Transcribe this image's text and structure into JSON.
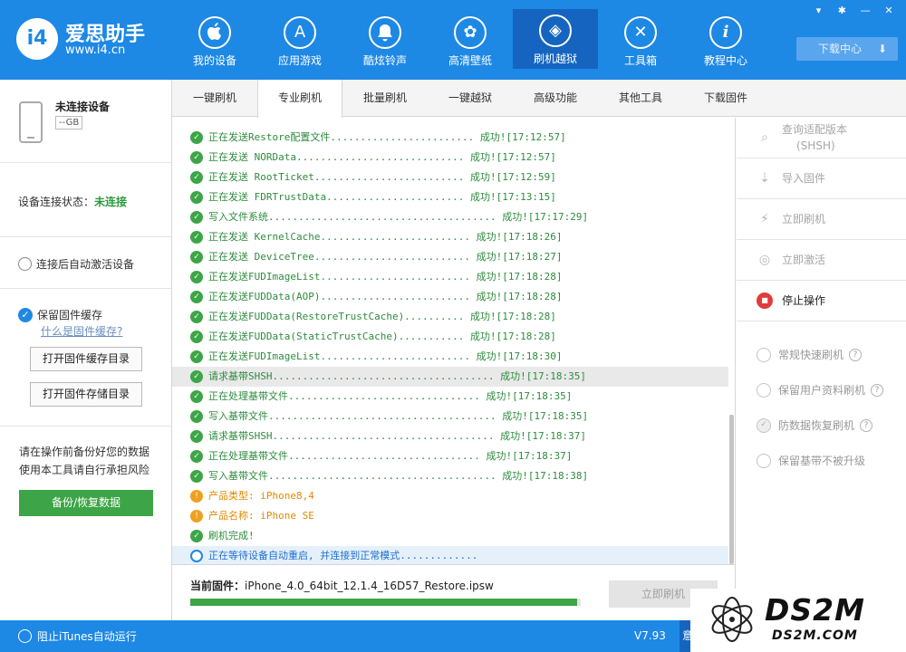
{
  "header": {
    "logo_mark": "i4",
    "app_name": "爱思助手",
    "url": "www.i4.cn",
    "nav": [
      {
        "label": "我的设备",
        "icon": "apple-icon",
        "glyph": ""
      },
      {
        "label": "应用游戏",
        "icon": "app-store-icon",
        "glyph": "A"
      },
      {
        "label": "酷炫铃声",
        "icon": "bell-icon",
        "glyph": "♪"
      },
      {
        "label": "高清壁纸",
        "icon": "flower-icon",
        "glyph": "✿"
      },
      {
        "label": "刷机越狱",
        "icon": "dropbox-icon",
        "glyph": "◈"
      },
      {
        "label": "工具箱",
        "icon": "tools-icon",
        "glyph": "✕"
      },
      {
        "label": "教程中心",
        "icon": "info-icon",
        "glyph": "i"
      }
    ],
    "download_center": "下载中心",
    "window_icons": [
      "shirt-icon",
      "gear-icon",
      "minimize-icon",
      "close-icon"
    ]
  },
  "left": {
    "device_name": "未连接设备",
    "device_storage": "--GB",
    "conn_label": "设备连接状态：",
    "conn_value": "未连接",
    "auto_activate": "连接后自动激活设备",
    "keep_cache": "保留固件缓存",
    "what_cache": "什么是固件缓存?",
    "open_cache_dir": "打开固件缓存目录",
    "open_store_dir": "打开固件存储目录",
    "warn1": "请在操作前备份好您的数据",
    "warn2": "使用本工具请自行承担风险",
    "backup": "备份/恢复数据"
  },
  "tabs": [
    "一键刷机",
    "专业刷机",
    "批量刷机",
    "一键越狱",
    "高级功能",
    "其他工具",
    "下载固件"
  ],
  "log": [
    {
      "text": "正在发送Restore配置文件........................ 成功![17:12:57]",
      "kind": "ok"
    },
    {
      "text": "正在发送 NORData............................ 成功![17:12:57]",
      "kind": "ok"
    },
    {
      "text": "正在发送 RootTicket......................... 成功![17:12:59]",
      "kind": "ok"
    },
    {
      "text": "正在发送 FDRTrustData....................... 成功![17:13:15]",
      "kind": "ok"
    },
    {
      "text": "写入文件系统...................................... 成功![17:17:29]",
      "kind": "ok"
    },
    {
      "text": "正在发送 KernelCache......................... 成功![17:18:26]",
      "kind": "ok"
    },
    {
      "text": "正在发送 DeviceTree.......................... 成功![17:18:27]",
      "kind": "ok"
    },
    {
      "text": "正在发送FUDImageList......................... 成功![17:18:28]",
      "kind": "ok"
    },
    {
      "text": "正在发送FUDData(AOP)......................... 成功![17:18:28]",
      "kind": "ok"
    },
    {
      "text": "正在发送FUDData(RestoreTrustCache).......... 成功![17:18:28]",
      "kind": "ok"
    },
    {
      "text": "正在发送FUDData(StaticTrustCache)........... 成功![17:18:28]",
      "kind": "ok"
    },
    {
      "text": "正在发送FUDImageList......................... 成功![17:18:30]",
      "kind": "ok"
    },
    {
      "text": "请求基带SHSH..................................... 成功![17:18:35]",
      "kind": "hl"
    },
    {
      "text": "正在处理基带文件................................ 成功![17:18:35]",
      "kind": "ok"
    },
    {
      "text": "写入基带文件...................................... 成功![17:18:35]",
      "kind": "ok"
    },
    {
      "text": "请求基带SHSH..................................... 成功![17:18:37]",
      "kind": "ok"
    },
    {
      "text": "正在处理基带文件................................ 成功![17:18:37]",
      "kind": "ok"
    },
    {
      "text": "写入基带文件...................................... 成功![17:18:38]",
      "kind": "ok"
    },
    {
      "text": "产品类型: iPhone8,4",
      "kind": "warn"
    },
    {
      "text": "产品名称: iPhone SE",
      "kind": "warn"
    },
    {
      "text": "刷机完成!",
      "kind": "ok"
    },
    {
      "text": "正在等待设备自动重启, 并连接到正常模式.............",
      "kind": "wait"
    }
  ],
  "firmware": {
    "label": "当前固件：",
    "file": "iPhone_4.0_64bit_12.1.4_16D57_Restore.ipsw",
    "progress_percent": 99,
    "flash_now": "立即刷机"
  },
  "right": {
    "query_line1": "查询适配版本",
    "query_line2": "(SHSH)",
    "import": "导入固件",
    "flash": "立即刷机",
    "activate": "立即激活",
    "stop": "停止操作",
    "options": [
      "常规快速刷机",
      "保留用户资料刷机",
      "防数据恢复刷机",
      "保留基带不被升级"
    ]
  },
  "footer": {
    "block_itunes": "阻止iTunes自动运行",
    "version": "V7.93",
    "feedback": "意"
  },
  "watermark": {
    "big": "DS2M",
    "small": "DS2M.COM"
  }
}
